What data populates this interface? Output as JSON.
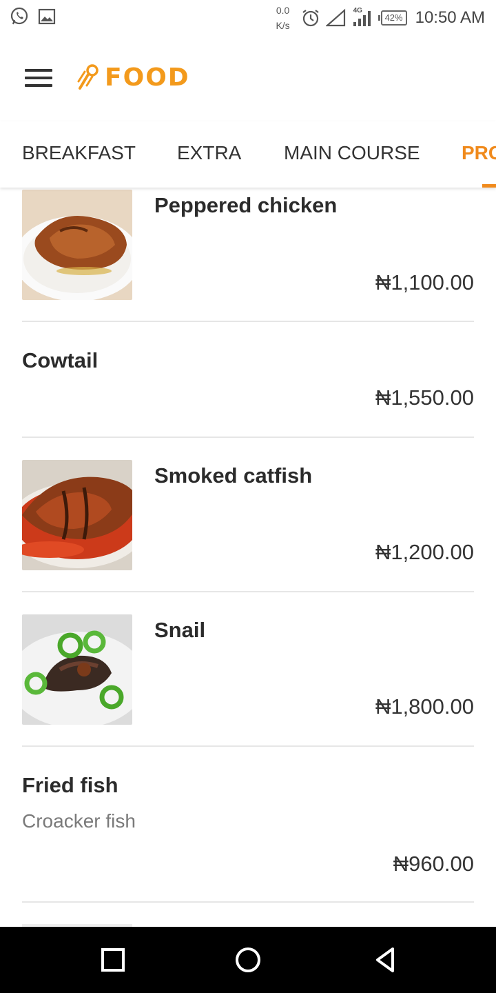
{
  "status": {
    "net_speed": "0.0",
    "net_unit": "K/s",
    "network_type": "4G",
    "battery": "42%",
    "time": "10:50 AM"
  },
  "app": {
    "logo_text": "FOOD",
    "accent": "#f08a1c"
  },
  "tabs": [
    {
      "label": "BREAKFAST",
      "active": false
    },
    {
      "label": "EXTRA",
      "active": false
    },
    {
      "label": "MAIN COURSE",
      "active": false
    },
    {
      "label": "PRO",
      "active": true
    }
  ],
  "items": [
    {
      "name": "Peppered chicken",
      "price": "₦1,100.00",
      "image": "peppered-chicken"
    },
    {
      "name": "Cowtail",
      "price": "₦1,550.00"
    },
    {
      "name": "Smoked catfish",
      "price": "₦1,200.00",
      "image": "smoked-catfish"
    },
    {
      "name": "Snail",
      "price": "₦1,800.00",
      "image": "snail"
    },
    {
      "name": "Fried fish",
      "description": "Croacker fish",
      "price": "₦960.00"
    }
  ]
}
